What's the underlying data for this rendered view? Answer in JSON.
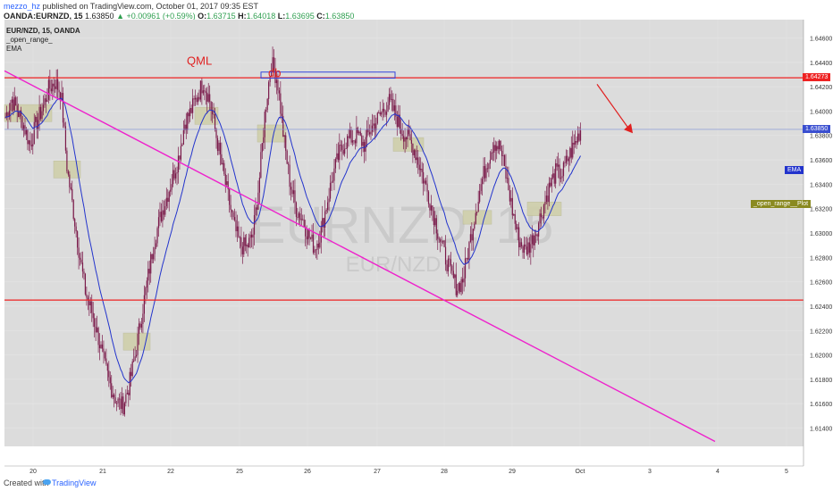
{
  "header": {
    "user": "mezzo_hz",
    "published_text": " published on TradingView.com, October 01, 2017 09:35 EST",
    "symbol_line": "OANDA:EURNZD, 15",
    "last": "1.63850",
    "change": "+0.00961 (+0.59%)",
    "o_label": "O:",
    "o_value": "1.63715",
    "h_label": "H:",
    "h_value": "1.64018",
    "l_label": "L:",
    "l_value": "1.63695",
    "c_label": "C:",
    "c_value": "1.63850"
  },
  "legend": {
    "symbol": "EUR/NZD, 15, OANDA",
    "ind1": "_open_range_",
    "ind2": "EMA"
  },
  "watermark": {
    "big": "EURNZD, 15",
    "small": "EUR/NZD"
  },
  "annotations": {
    "qml": "QML",
    "db": "db"
  },
  "tags": {
    "level_top": "1.64273",
    "last_price": "1.63850",
    "ema": "EMA",
    "open_range": "_open_range__Plot"
  },
  "colors": {
    "bg": "#dcdcdc",
    "candle": "#7a1a4a",
    "ema": "#2233cc",
    "hline": "#ee2222",
    "trend": "#ee22cc",
    "box_fill": "#cfcfa8",
    "last_line": "#7f8fd8"
  },
  "chart_data": {
    "type": "candlestick",
    "ylim": [
      1.6125,
      1.6475
    ],
    "y_ticks": [
      "1.64600",
      "1.64400",
      "1.64200",
      "1.64000",
      "1.63800",
      "1.63600",
      "1.63400",
      "1.63200",
      "1.63000",
      "1.62800",
      "1.62600",
      "1.62400",
      "1.62200",
      "1.62000",
      "1.61800",
      "1.61600",
      "1.61400"
    ],
    "x_ticks": [
      "20",
      "21",
      "22",
      "25",
      "26",
      "27",
      "28",
      "29",
      "Oct",
      "3",
      "4",
      "5"
    ],
    "horizontal_levels": [
      1.64273,
      1.6245
    ],
    "last_price": 1.6385,
    "close_path": [
      1.6395,
      1.641,
      1.64,
      1.6388,
      1.6372,
      1.639,
      1.6402,
      1.6418,
      1.6424,
      1.6415,
      1.6352,
      1.6318,
      1.6282,
      1.625,
      1.6235,
      1.6215,
      1.6192,
      1.6175,
      1.6162,
      1.6158,
      1.6175,
      1.62,
      1.6232,
      1.6262,
      1.6292,
      1.6312,
      1.6328,
      1.6345,
      1.6362,
      1.639,
      1.64,
      1.6412,
      1.6424,
      1.641,
      1.6382,
      1.6355,
      1.633,
      1.6305,
      1.629,
      1.6288,
      1.6298,
      1.634,
      1.64,
      1.644,
      1.6425,
      1.6378,
      1.6342,
      1.632,
      1.6312,
      1.6298,
      1.6288,
      1.63,
      1.6325,
      1.6348,
      1.6365,
      1.6375,
      1.6378,
      1.638,
      1.6372,
      1.6385,
      1.6392,
      1.64,
      1.6408,
      1.6398,
      1.6385,
      1.6378,
      1.637,
      1.6355,
      1.6338,
      1.632,
      1.63,
      1.6282,
      1.6268,
      1.6255,
      1.6262,
      1.629,
      1.6318,
      1.6342,
      1.636,
      1.6375,
      1.637,
      1.6345,
      1.6318,
      1.6295,
      1.6285,
      1.6292,
      1.6305,
      1.6322,
      1.6338,
      1.635,
      1.6348,
      1.6362,
      1.6372,
      1.6385
    ]
  },
  "footer": {
    "created": "Created with",
    "brand": "TradingView"
  }
}
